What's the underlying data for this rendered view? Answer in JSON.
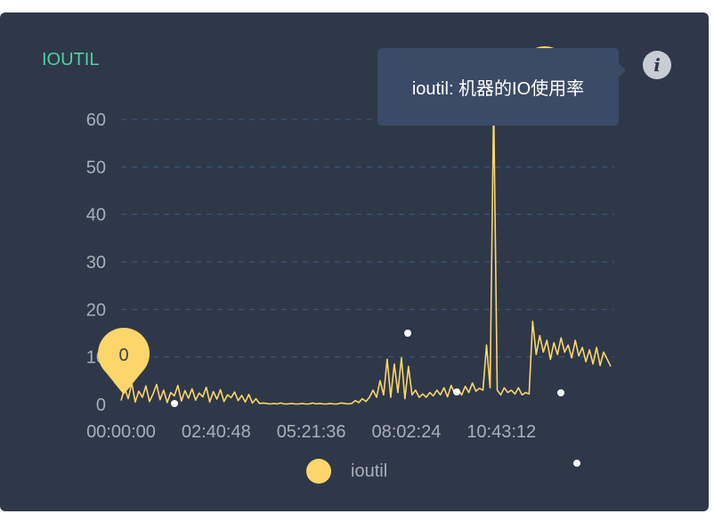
{
  "panel": {
    "title": "IOUTIL",
    "tooltip": "ioutil: 机器的IO使用率"
  },
  "colors": {
    "panel_bg": "#2f3848",
    "title": "#4fd1a3",
    "series": "#fcd66b",
    "grid": "#3d5a85",
    "axis_text": "#a9afb9",
    "tooltip_bg": "#3b4a66"
  },
  "icons": {
    "info": "info-icon"
  },
  "chart_data": {
    "type": "line",
    "x_ticks": [
      "00:00:00",
      "02:40:48",
      "05:21:36",
      "08:02:24",
      "10:43:12"
    ],
    "y_ticks": [
      0,
      10,
      20,
      30,
      40,
      50,
      60
    ],
    "ylim": [
      0,
      65
    ],
    "grid": true,
    "legend_position": "bottom",
    "markpoint_label": "0",
    "series": [
      {
        "name": "ioutil",
        "x_hours": [
          0.0,
          0.1,
          0.2,
          0.3,
          0.4,
          0.5,
          0.6,
          0.7,
          0.8,
          0.9,
          1.0,
          1.1,
          1.2,
          1.3,
          1.4,
          1.5,
          1.6,
          1.7,
          1.8,
          1.9,
          2.0,
          2.1,
          2.2,
          2.3,
          2.4,
          2.5,
          2.6,
          2.7,
          2.8,
          2.9,
          3.0,
          3.1,
          3.2,
          3.3,
          3.4,
          3.5,
          3.6,
          3.7,
          3.8,
          3.9,
          4.0,
          4.1,
          4.2,
          4.3,
          4.4,
          4.5,
          4.6,
          4.7,
          4.8,
          4.9,
          5.0,
          5.1,
          5.2,
          5.3,
          5.4,
          5.5,
          5.6,
          5.7,
          5.8,
          5.9,
          6.0,
          6.1,
          6.2,
          6.3,
          6.4,
          6.5,
          6.6,
          6.7,
          6.8,
          6.9,
          7.0,
          7.1,
          7.2,
          7.3,
          7.4,
          7.5,
          7.6,
          7.7,
          7.8,
          7.9,
          8.0,
          8.1,
          8.2,
          8.3,
          8.4,
          8.5,
          8.6,
          8.7,
          8.8,
          8.9,
          9.0,
          9.1,
          9.2,
          9.3,
          9.4,
          9.5,
          9.6,
          9.7,
          9.8,
          9.9,
          10.0,
          10.1,
          10.2,
          10.3,
          10.4,
          10.5,
          10.6,
          10.7,
          10.8,
          10.9,
          11.0,
          11.1,
          11.2,
          11.3,
          11.4,
          11.5,
          11.6,
          11.7,
          11.8,
          11.9,
          12.0,
          12.1,
          12.2,
          12.3,
          12.4,
          12.5,
          12.6,
          12.7,
          12.8,
          12.9,
          13.0,
          13.1,
          13.2,
          13.3,
          13.4,
          13.5,
          13.6,
          13.7,
          13.8
        ],
        "values": [
          0.8,
          3.5,
          1.2,
          4.5,
          0.5,
          2.8,
          1.5,
          3.9,
          0.6,
          2.2,
          4.2,
          1.0,
          3.0,
          0.4,
          2.5,
          1.8,
          4.0,
          0.7,
          2.9,
          1.3,
          3.3,
          0.9,
          2.4,
          1.6,
          3.6,
          0.5,
          2.7,
          1.1,
          3.1,
          0.6,
          2.0,
          1.4,
          2.6,
          0.8,
          1.9,
          0.5,
          2.1,
          0.3,
          1.2,
          0.2,
          0.3,
          0.2,
          0.1,
          0.2,
          0.1,
          0.3,
          0.1,
          0.1,
          0.2,
          0.1,
          0.1,
          0.2,
          0.1,
          0.1,
          0.3,
          0.1,
          0.2,
          0.1,
          0.1,
          0.2,
          0.1,
          0.1,
          0.3,
          0.2,
          0.1,
          0.2,
          0.8,
          0.4,
          1.2,
          0.6,
          1.5,
          3.0,
          1.5,
          5.0,
          2.0,
          9.5,
          1.5,
          8.5,
          2.5,
          9.8,
          1.2,
          8.0,
          2.0,
          3.0,
          1.5,
          2.2,
          1.5,
          2.5,
          1.8,
          3.0,
          2.0,
          3.5,
          1.6,
          4.0,
          2.4,
          3.2,
          2.0,
          3.8,
          2.5,
          4.5,
          2.8,
          3.4,
          3.0,
          12.5,
          3.5,
          63.5,
          3.0,
          2.0,
          3.5,
          2.5,
          3.0,
          2.2,
          3.5,
          2.0,
          2.5,
          2.2,
          17.5,
          10.5,
          14.5,
          11.0,
          13.5,
          9.5,
          13.0,
          10.5,
          14.0,
          11.0,
          12.5,
          9.8,
          13.5,
          10.2,
          12.0,
          9.0,
          11.5,
          8.5,
          12.0,
          8.2,
          11.0,
          9.5,
          8.0
        ]
      }
    ]
  }
}
